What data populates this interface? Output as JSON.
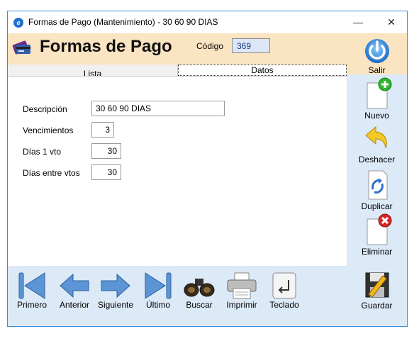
{
  "window": {
    "title": "Formas de Pago (Mantenimiento) - 30 60 90 DIAS",
    "minimize": "—",
    "close": "✕"
  },
  "header": {
    "title": "Formas de Pago",
    "codigo_label": "Código",
    "codigo_value": "369"
  },
  "tabs": [
    {
      "label": "Lista"
    },
    {
      "label": "Datos"
    }
  ],
  "form": {
    "descripcion_label": "Descripción",
    "descripcion_value": "30 60 90 DIAS",
    "vencimientos_label": "Vencimientos",
    "vencimientos_value": "3",
    "dias1_label": "Días 1 vto",
    "dias1_value": "30",
    "dias_entre_label": "Días entre vtos",
    "dias_entre_value": "30"
  },
  "sidebar": {
    "salir": "Salir",
    "nuevo": "Nuevo",
    "deshacer": "Deshacer",
    "duplicar": "Duplicar",
    "eliminar": "Eliminar",
    "guardar": "Guardar"
  },
  "toolbar": {
    "primero": "Primero",
    "anterior": "Anterior",
    "siguiente": "Siguiente",
    "ultimo": "Último",
    "buscar": "Buscar",
    "imprimir": "Imprimir",
    "teclado": "Teclado"
  },
  "colors": {
    "accent_blue": "#1e6fcf",
    "header_bg": "#fbe4c1",
    "frame_bg": "#dce9f7"
  }
}
